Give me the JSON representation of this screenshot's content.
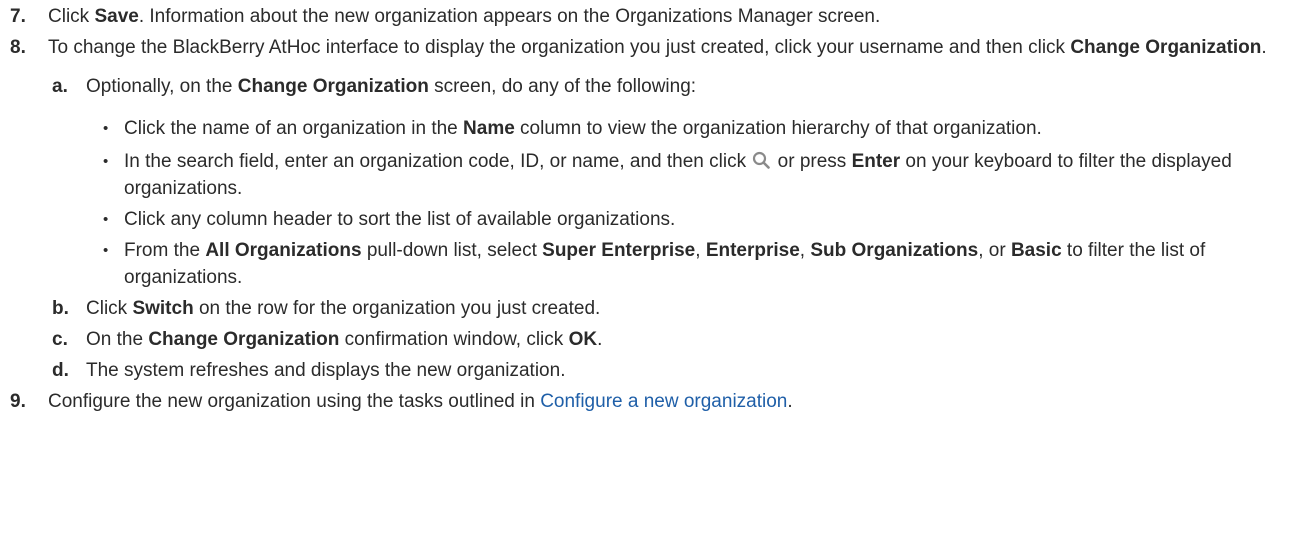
{
  "step7": {
    "number": "7.",
    "pre": "Click ",
    "bold1": "Save",
    "post": ". Information about the new organization appears on the Organizations Manager screen."
  },
  "step8": {
    "number": "8.",
    "pre": "To change the BlackBerry AtHoc interface to display the organization you just created, click your username and then click ",
    "bold1": "Change Organization",
    "post": "."
  },
  "sub_a": {
    "letter": "a.",
    "pre": "Optionally, on the ",
    "bold1": "Change Organization",
    "post": " screen, do any of the following:"
  },
  "bullets": [
    {
      "pre": "Click the name of an organization in the ",
      "bold1": "Name",
      "post": " column to view the organization hierarchy of that organization."
    },
    {
      "pre": "In the search field, enter an organization code, ID, or name, and then click ",
      "icon": "search-icon",
      "mid": " or press ",
      "bold1": "Enter",
      "post": " on your keyboard to filter the displayed organizations."
    },
    {
      "pre": "Click any column header to sort the list of available organizations."
    },
    {
      "pre": "From the ",
      "bold1": "All Organizations",
      "mid1": " pull-down list, select ",
      "bold2": "Super Enterprise",
      "sep1": ", ",
      "bold3": "Enterprise",
      "sep2": ", ",
      "bold4": "Sub Organizations",
      "sep3": ", or ",
      "bold5": "Basic",
      "post": " to filter the list of organizations."
    }
  ],
  "sub_b": {
    "letter": "b.",
    "pre": "Click ",
    "bold1": "Switch",
    "post": " on the row for the organization you just created."
  },
  "sub_c": {
    "letter": "c.",
    "pre": "On the ",
    "bold1": "Change Organization",
    "mid": " confirmation window, click ",
    "bold2": "OK",
    "post": "."
  },
  "sub_d": {
    "letter": "d.",
    "text": "The system refreshes and displays the new organization."
  },
  "step9": {
    "number": "9.",
    "pre": "Configure the new organization using the tasks outlined in ",
    "link": "Configure a new organization",
    "post": "."
  },
  "colors": {
    "text": "#2b2b2b",
    "link": "#1f5fa8",
    "icon": "#8a8a8a"
  }
}
